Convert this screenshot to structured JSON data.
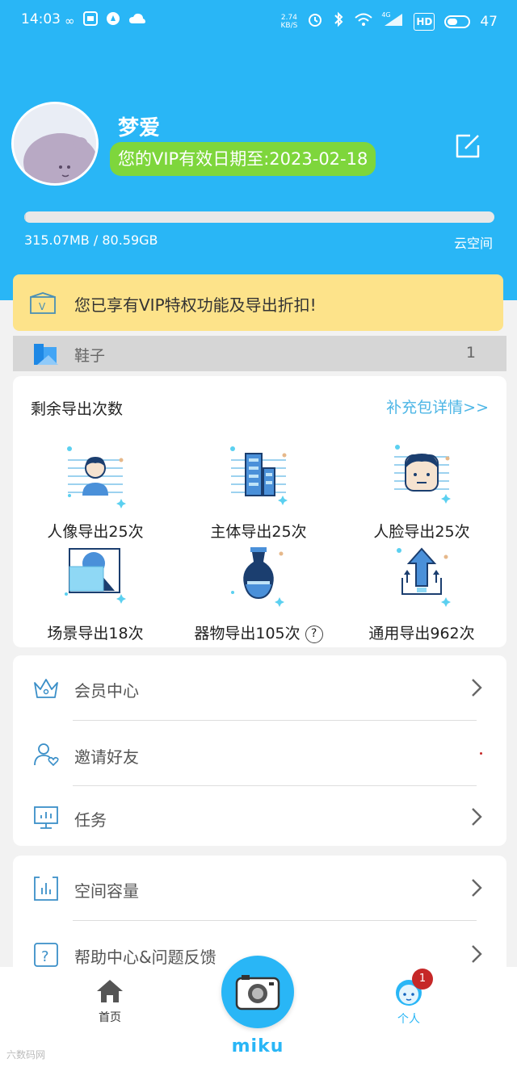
{
  "status_bar": {
    "time": "14:03",
    "net_speed_value": "2.74",
    "net_speed_unit": "KB/S",
    "signal_label": "4G",
    "hd_label": "HD",
    "battery": "47",
    "icons": [
      "infinity-icon",
      "fm-icon",
      "compass-icon",
      "cloud-icon",
      "alarm-icon",
      "bluetooth-icon",
      "wifi-icon",
      "signal-icon",
      "battery-icon"
    ]
  },
  "profile": {
    "username": "梦爱",
    "vip_text": "您的VIP有效日期至:2023-02-18",
    "storage_text": "315.07MB / 80.59GB",
    "cloud_label": "云空间",
    "storage_used_fraction": 0.004
  },
  "vip_banner": {
    "text": "您已享有VIP特权功能及导出折扣!"
  },
  "category": {
    "name": "鞋子",
    "count": "1"
  },
  "exports": {
    "title": "剩余导出次数",
    "link": "补充包详情>>",
    "items": [
      {
        "label": "人像导出25次",
        "icon": "portrait-export-icon"
      },
      {
        "label": "主体导出25次",
        "icon": "subject-export-icon"
      },
      {
        "label": "人脸导出25次",
        "icon": "face-export-icon"
      },
      {
        "label": "场景导出18次",
        "icon": "scene-export-icon"
      },
      {
        "label": "器物导出105次",
        "icon": "object-export-icon",
        "help": "?"
      },
      {
        "label": "通用导出962次",
        "icon": "general-export-icon"
      }
    ]
  },
  "menu1": [
    {
      "label": "会员中心",
      "icon": "crown-icon"
    },
    {
      "label": "邀请好友",
      "icon": "invite-user-icon"
    },
    {
      "label": "任务",
      "icon": "task-board-icon"
    }
  ],
  "menu2": [
    {
      "label": "空间容量",
      "icon": "storage-chart-icon"
    },
    {
      "label": "帮助中心&问题反馈",
      "icon": "help-icon"
    }
  ],
  "bottom_nav": {
    "home_label": "首页",
    "brand": "miku",
    "profile_label": "个人",
    "profile_badge": "1"
  },
  "watermark": "六数码网",
  "colors": {
    "primary": "#29b6f6",
    "vip_green": "#7ed63c",
    "banner_yellow": "#fde38a",
    "badge_red": "#c62828"
  }
}
